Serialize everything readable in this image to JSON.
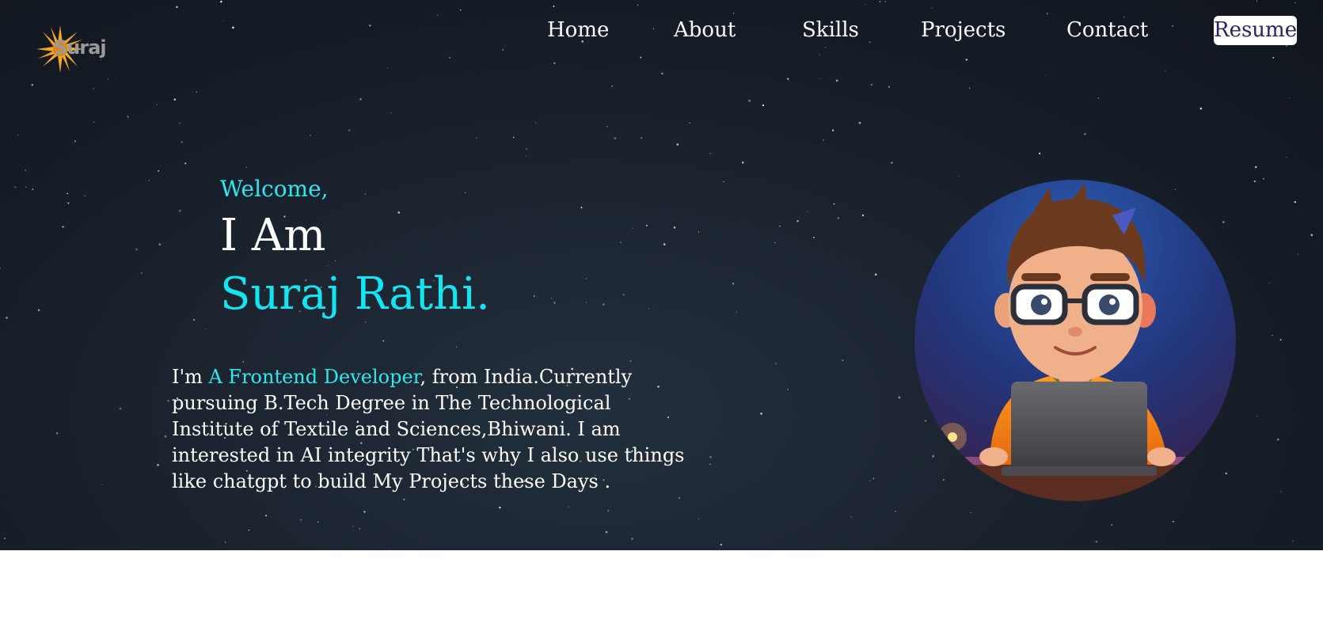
{
  "brand": {
    "logo_text": "Suraj",
    "logo_icon": "sun-icon"
  },
  "nav": {
    "items": [
      {
        "label": "Home"
      },
      {
        "label": "About"
      },
      {
        "label": "Skills"
      },
      {
        "label": "Projects"
      },
      {
        "label": "Contact"
      }
    ],
    "resume_label": "Resume"
  },
  "hero": {
    "greeting": "Welcome,",
    "intro": "I Am",
    "name": "Suraj Rathi.",
    "bio_prefix": "I'm ",
    "bio_highlight": "A Frontend Developer",
    "bio_rest": ", from India.Currently pursuing B.Tech Degree in The Technological Institute of Textile and Sciences,Bhiwani. I am interested in AI integrity That's why I also use things like chatgpt to build My Projects these Days ."
  },
  "colors": {
    "accent": "#2ee8f0",
    "background": "#1a222d",
    "resume_text": "#2a2560"
  },
  "avatar": {
    "icon": "developer-avatar-illustration"
  }
}
